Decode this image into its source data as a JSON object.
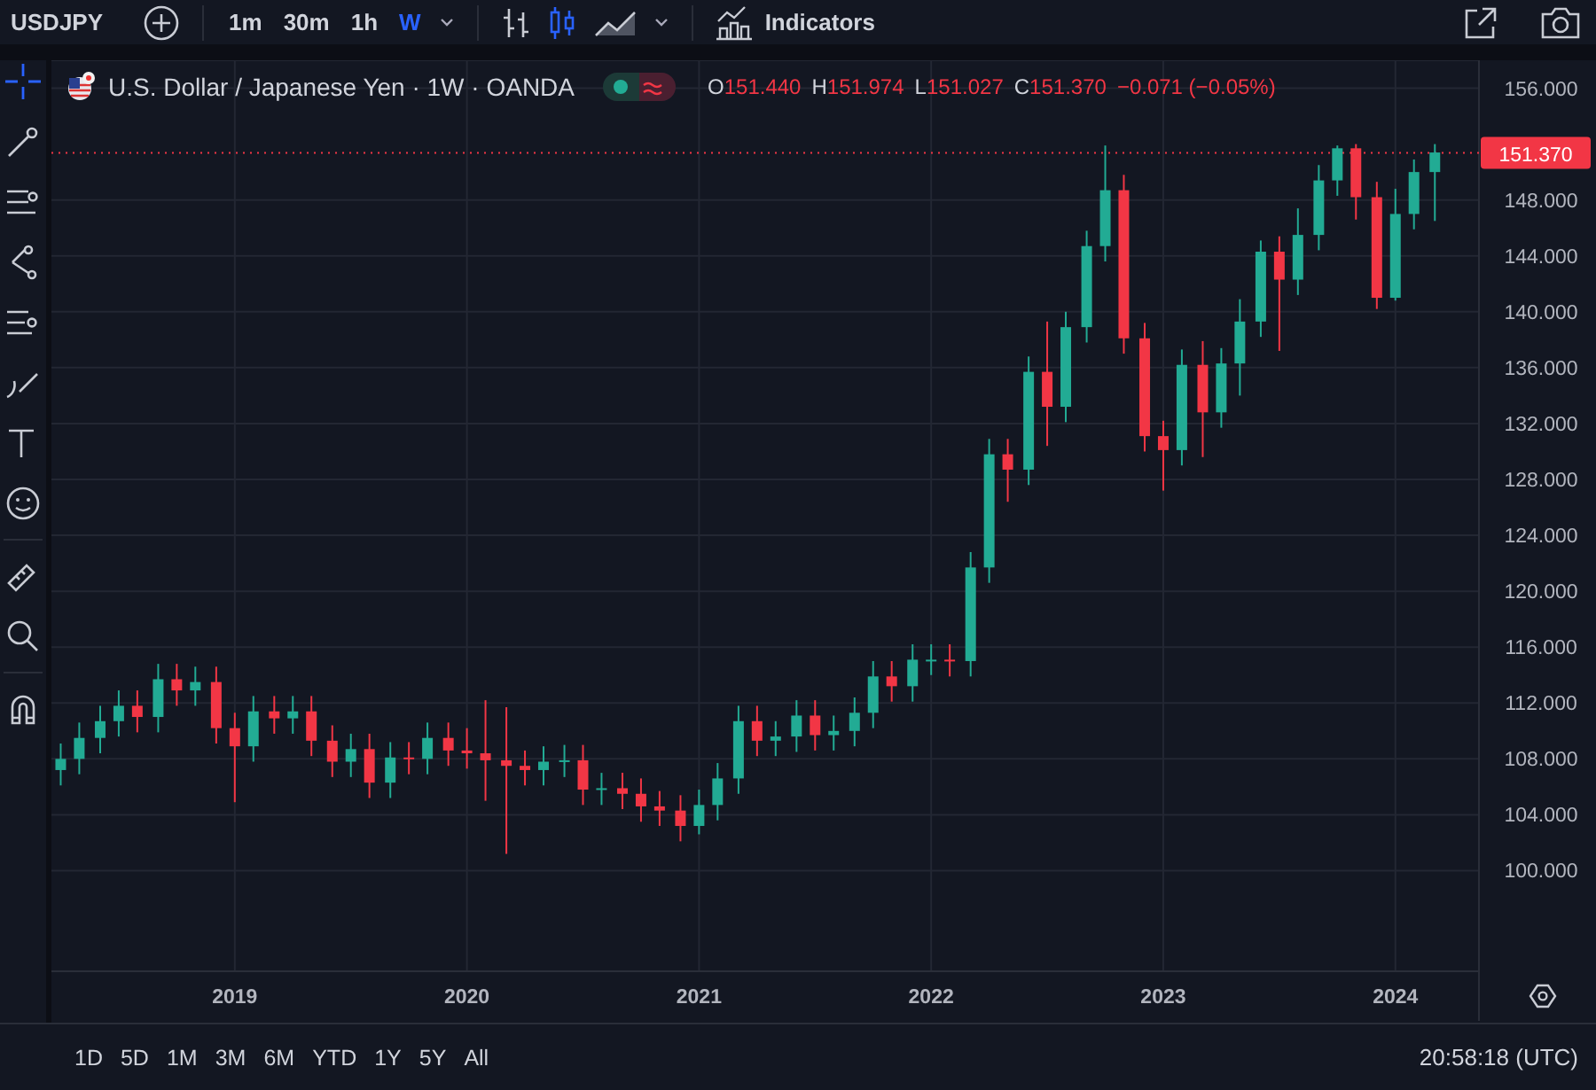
{
  "toolbar": {
    "symbol": "USDJPY",
    "intervals": [
      {
        "label": "1m",
        "selected": false
      },
      {
        "label": "30m",
        "selected": false
      },
      {
        "label": "1h",
        "selected": false
      },
      {
        "label": "W",
        "selected": true
      }
    ],
    "chart_styles": [
      {
        "kind": "bars",
        "selected": false
      },
      {
        "kind": "candles",
        "selected": true
      },
      {
        "kind": "area",
        "selected": false
      }
    ],
    "indicators_label": "Indicators"
  },
  "legend": {
    "title": "U.S. Dollar / Japanese Yen · 1W · OANDA",
    "ohlc": [
      {
        "label": "O",
        "value": "151.440"
      },
      {
        "label": "H",
        "value": "151.974"
      },
      {
        "label": "L",
        "value": "151.027"
      },
      {
        "label": "C",
        "value": "151.370"
      }
    ],
    "change": "−0.071 (−0.05%)",
    "market_open": true
  },
  "chart": {
    "chart_data": {
      "type": "candlestick",
      "grid": true,
      "x": [
        2018.25,
        2018.33,
        2018.42,
        2018.5,
        2018.58,
        2018.67,
        2018.75,
        2018.83,
        2018.92,
        2019.0,
        2019.08,
        2019.17,
        2019.25,
        2019.33,
        2019.42,
        2019.5,
        2019.58,
        2019.67,
        2019.75,
        2019.83,
        2019.92,
        2020.0,
        2020.08,
        2020.17,
        2020.25,
        2020.33,
        2020.42,
        2020.5,
        2020.58,
        2020.67,
        2020.75,
        2020.83,
        2020.92,
        2021.0,
        2021.08,
        2021.17,
        2021.25,
        2021.33,
        2021.42,
        2021.5,
        2021.58,
        2021.67,
        2021.75,
        2021.83,
        2021.92,
        2022.0,
        2022.08,
        2022.17,
        2022.25,
        2022.33,
        2022.42,
        2022.5,
        2022.58,
        2022.67,
        2022.75,
        2022.83,
        2022.92,
        2023.0,
        2023.08,
        2023.17,
        2023.25,
        2023.33,
        2023.42,
        2023.5,
        2023.58,
        2023.67,
        2023.75,
        2023.83,
        2023.92,
        2024.0,
        2024.08,
        2024.17
      ],
      "ohlc": [
        [
          107.2,
          109.1,
          106.1,
          108.0
        ],
        [
          108.0,
          110.6,
          106.9,
          109.5
        ],
        [
          109.5,
          111.8,
          108.4,
          110.7
        ],
        [
          110.7,
          112.9,
          109.6,
          111.8
        ],
        [
          111.8,
          112.9,
          109.9,
          111.0
        ],
        [
          111.0,
          114.8,
          109.9,
          113.7
        ],
        [
          113.7,
          114.8,
          111.8,
          112.9
        ],
        [
          112.9,
          114.6,
          111.8,
          113.5
        ],
        [
          113.5,
          114.6,
          109.1,
          110.2
        ],
        [
          110.2,
          111.3,
          104.9,
          108.9
        ],
        [
          108.9,
          112.5,
          107.8,
          111.4
        ],
        [
          111.4,
          112.5,
          109.8,
          110.9
        ],
        [
          110.9,
          112.5,
          109.8,
          111.4
        ],
        [
          111.4,
          112.5,
          108.2,
          109.3
        ],
        [
          109.3,
          110.4,
          106.7,
          107.8
        ],
        [
          107.8,
          109.8,
          106.7,
          108.7
        ],
        [
          108.7,
          109.8,
          105.2,
          106.3
        ],
        [
          106.3,
          109.2,
          105.2,
          108.1
        ],
        [
          108.1,
          109.2,
          106.9,
          108.0
        ],
        [
          108.0,
          110.6,
          106.9,
          109.5
        ],
        [
          109.5,
          110.6,
          107.5,
          108.6
        ],
        [
          108.6,
          110.2,
          107.3,
          108.4
        ],
        [
          108.4,
          112.2,
          105.0,
          107.9
        ],
        [
          107.9,
          111.7,
          101.2,
          107.5
        ],
        [
          107.5,
          108.6,
          106.1,
          107.2
        ],
        [
          107.2,
          108.9,
          106.1,
          107.8
        ],
        [
          107.8,
          109.0,
          106.7,
          107.9
        ],
        [
          107.9,
          109.0,
          104.7,
          105.8
        ],
        [
          105.8,
          107.0,
          104.7,
          105.9
        ],
        [
          105.9,
          107.0,
          104.4,
          105.5
        ],
        [
          105.5,
          106.6,
          103.5,
          104.6
        ],
        [
          104.6,
          105.7,
          103.2,
          104.3
        ],
        [
          104.3,
          105.4,
          102.1,
          103.2
        ],
        [
          103.2,
          105.8,
          102.6,
          104.7
        ],
        [
          104.7,
          107.7,
          103.6,
          106.6
        ],
        [
          106.6,
          111.8,
          105.5,
          110.7
        ],
        [
          110.7,
          111.8,
          108.2,
          109.3
        ],
        [
          109.3,
          110.7,
          108.2,
          109.6
        ],
        [
          109.6,
          112.2,
          108.5,
          111.1
        ],
        [
          111.1,
          112.2,
          108.6,
          109.7
        ],
        [
          109.7,
          111.1,
          108.6,
          110.0
        ],
        [
          110.0,
          112.4,
          108.9,
          111.3
        ],
        [
          111.3,
          115.0,
          110.2,
          113.9
        ],
        [
          113.9,
          115.0,
          112.1,
          113.2
        ],
        [
          113.2,
          116.2,
          112.1,
          115.1
        ],
        [
          115.1,
          116.2,
          114.0,
          115.1
        ],
        [
          115.1,
          116.2,
          113.9,
          115.0
        ],
        [
          115.0,
          122.8,
          113.9,
          121.7
        ],
        [
          121.7,
          130.9,
          120.6,
          129.8
        ],
        [
          129.8,
          130.9,
          126.4,
          128.7
        ],
        [
          128.7,
          136.8,
          127.6,
          135.7
        ],
        [
          135.7,
          139.3,
          130.4,
          133.2
        ],
        [
          133.2,
          140.0,
          132.1,
          138.9
        ],
        [
          138.9,
          145.8,
          137.8,
          144.7
        ],
        [
          144.7,
          151.9,
          143.6,
          148.7
        ],
        [
          148.7,
          149.8,
          137.0,
          138.1
        ],
        [
          138.1,
          139.2,
          130.0,
          131.1
        ],
        [
          131.1,
          132.2,
          127.2,
          130.1
        ],
        [
          130.1,
          137.3,
          129.0,
          136.2
        ],
        [
          136.2,
          137.9,
          129.6,
          132.8
        ],
        [
          132.8,
          137.4,
          131.7,
          136.3
        ],
        [
          136.3,
          140.9,
          134.0,
          139.3
        ],
        [
          139.3,
          145.1,
          138.2,
          144.3
        ],
        [
          144.3,
          145.4,
          137.2,
          142.3
        ],
        [
          142.3,
          147.4,
          141.2,
          145.5
        ],
        [
          145.5,
          150.5,
          144.4,
          149.4
        ],
        [
          149.4,
          151.9,
          148.3,
          151.7
        ],
        [
          151.7,
          152.0,
          146.6,
          148.2
        ],
        [
          148.2,
          149.3,
          140.2,
          141.0
        ],
        [
          141.0,
          148.8,
          140.8,
          147.0
        ],
        [
          147.0,
          150.9,
          145.9,
          150.0
        ],
        [
          150.0,
          152.0,
          146.5,
          151.4
        ]
      ],
      "ref_lines": [
        {
          "axis": "y",
          "value": 151.37,
          "label": "151.370",
          "color": "#f23645"
        }
      ],
      "xlim": [
        2018.21,
        2024.36
      ],
      "xticks": [
        {
          "value": 2019,
          "label": "2019"
        },
        {
          "value": 2020,
          "label": "2020"
        },
        {
          "value": 2021,
          "label": "2021"
        },
        {
          "value": 2022,
          "label": "2022"
        },
        {
          "value": 2023,
          "label": "2023"
        },
        {
          "value": 2024,
          "label": "2024"
        }
      ],
      "yticks": [
        {
          "value": 100,
          "label": "100.000"
        },
        {
          "value": 104,
          "label": "104.000"
        },
        {
          "value": 108,
          "label": "108.000"
        },
        {
          "value": 112,
          "label": "112.000"
        },
        {
          "value": 116,
          "label": "116.000"
        },
        {
          "value": 120,
          "label": "120.000"
        },
        {
          "value": 124,
          "label": "124.000"
        },
        {
          "value": 128,
          "label": "128.000"
        },
        {
          "value": 132,
          "label": "132.000"
        },
        {
          "value": 136,
          "label": "136.000"
        },
        {
          "value": 140,
          "label": "140.000"
        },
        {
          "value": 144,
          "label": "144.000"
        },
        {
          "value": 148,
          "label": "148.000"
        },
        {
          "value": 156,
          "label": "156.000"
        }
      ],
      "ylim": [
        92.8,
        158.0
      ]
    }
  },
  "bottom_bar": {
    "ranges": [
      "1D",
      "5D",
      "1M",
      "3M",
      "6M",
      "YTD",
      "1Y",
      "5Y",
      "All"
    ],
    "time": "20:58:18 (UTC)"
  }
}
